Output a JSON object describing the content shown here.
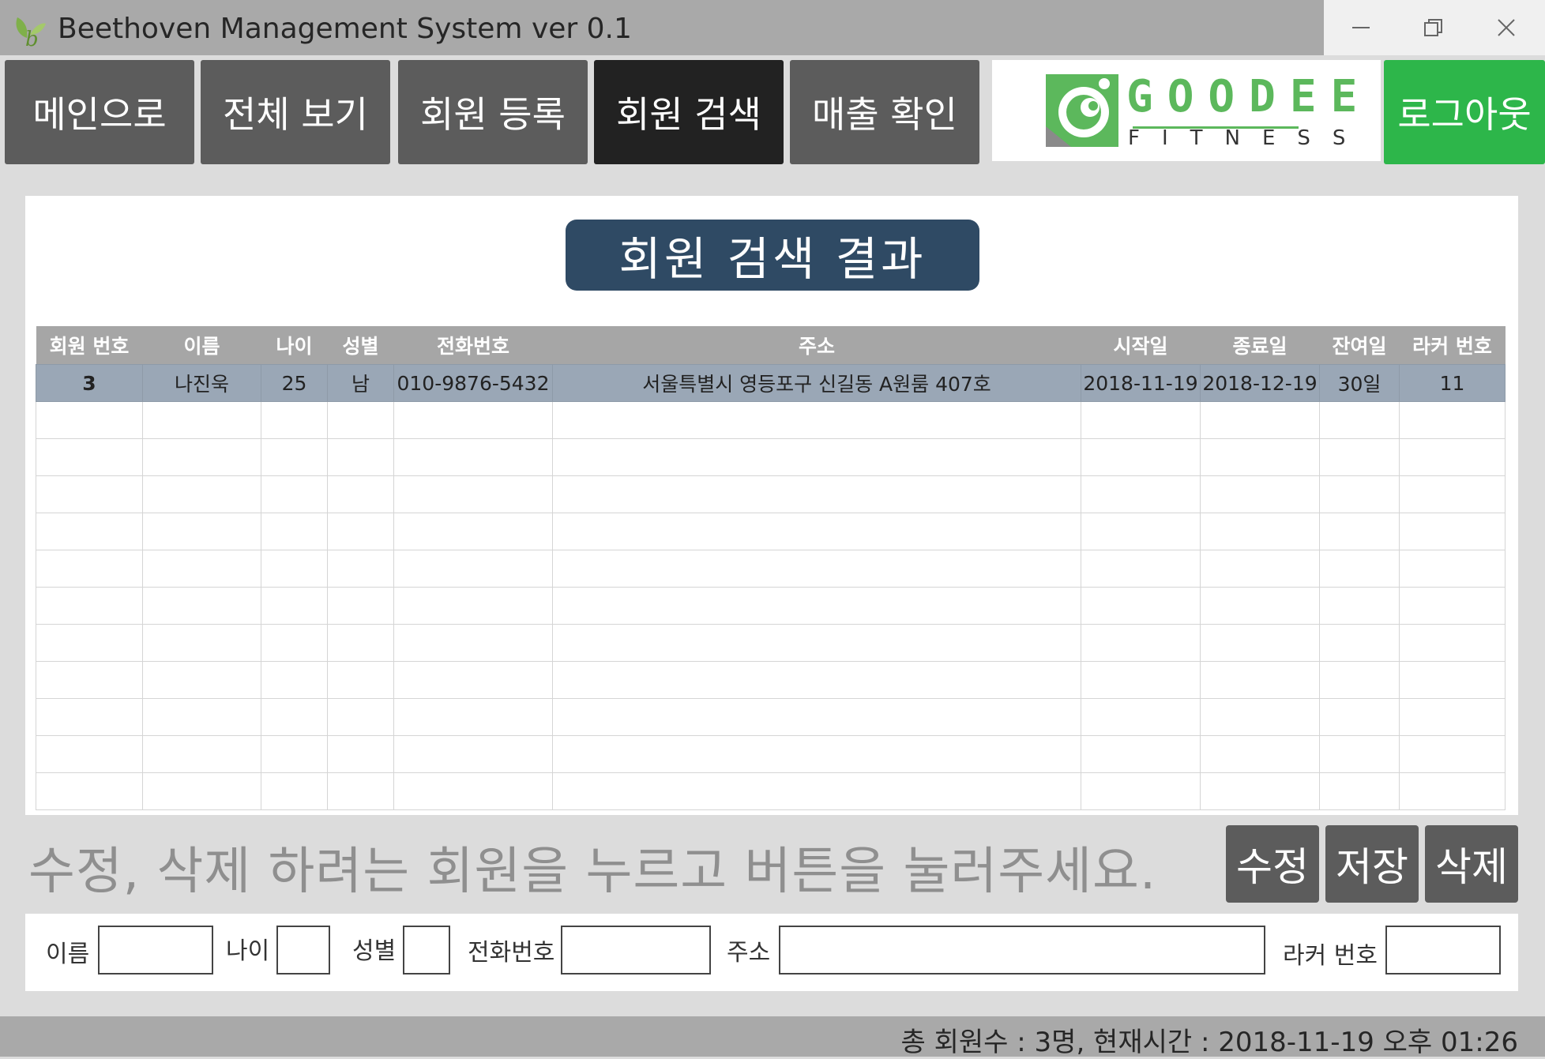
{
  "window": {
    "title": "Beethoven Management System ver 0.1",
    "icon": "leaf-b-icon",
    "controls": [
      "minimize-icon",
      "restore-icon",
      "close-icon"
    ]
  },
  "nav": {
    "main": "메인으로",
    "view_all": "전체 보기",
    "register": "회원 등록",
    "search": "회원 검색",
    "sales": "매출 확인",
    "logout": "로그아웃"
  },
  "logo": {
    "word1": "GOODEE",
    "word2": "FITNESS"
  },
  "result": {
    "title": "회원 검색 결과",
    "columns": [
      "회원 번호",
      "이름",
      "나이",
      "성별",
      "전화번호",
      "주소",
      "시작일",
      "종료일",
      "잔여일",
      "라커 번호"
    ],
    "rows": [
      [
        "3",
        "나진욱",
        "25",
        "남",
        "010-9876-5432",
        "서울특별시 영등포구 신길동 A원룸 407호",
        "2018-11-19",
        "2018-12-19",
        "30일",
        "11"
      ]
    ]
  },
  "hint": "수정, 삭제 하려는 회원을 누르고 버튼을 눌러주세요.",
  "actions": {
    "edit": "수정",
    "save": "저장",
    "delete": "삭제"
  },
  "form": {
    "name_label": "이름",
    "age_label": "나이",
    "gender_label": "성별",
    "phone_label": "전화번호",
    "address_label": "주소",
    "locker_label": "라커 번호"
  },
  "status": "총 회원수 : 3명, 현재시간 : 2018-11-19 오후 01:26",
  "colors": {
    "accent_green": "#2db64a",
    "title_navy": "#2f4a64",
    "nav_gray": "#5c5c5c",
    "nav_active": "#222222"
  }
}
